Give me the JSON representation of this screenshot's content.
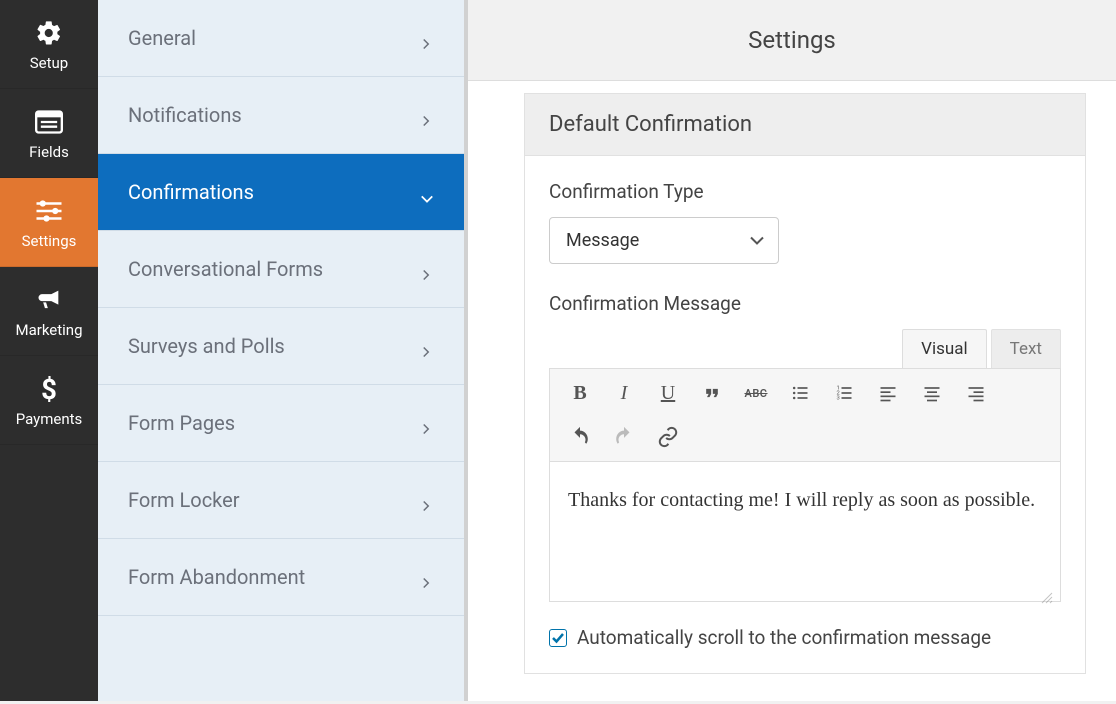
{
  "nav": {
    "items": [
      {
        "label": "Setup",
        "icon": "gear"
      },
      {
        "label": "Fields",
        "icon": "list"
      },
      {
        "label": "Settings",
        "icon": "sliders",
        "active": true
      },
      {
        "label": "Marketing",
        "icon": "bullhorn"
      },
      {
        "label": "Payments",
        "icon": "dollar"
      }
    ]
  },
  "sidebar": {
    "items": [
      {
        "label": "General"
      },
      {
        "label": "Notifications"
      },
      {
        "label": "Confirmations",
        "active": true
      },
      {
        "label": "Conversational Forms"
      },
      {
        "label": "Surveys and Polls"
      },
      {
        "label": "Form Pages"
      },
      {
        "label": "Form Locker"
      },
      {
        "label": "Form Abandonment"
      }
    ]
  },
  "header": {
    "title": "Settings"
  },
  "panel": {
    "title": "Default Confirmation",
    "type_label": "Confirmation Type",
    "type_value": "Message",
    "message_label": "Confirmation Message",
    "tabs": {
      "visual": "Visual",
      "text": "Text"
    },
    "message_value": "Thanks for contacting me! I will reply as soon as possible.",
    "checkbox_label": "Automatically scroll to the confirmation message",
    "checkbox_checked": true
  },
  "toolbar_text": {
    "bold": "B",
    "italic": "I",
    "strike": "ABC"
  }
}
